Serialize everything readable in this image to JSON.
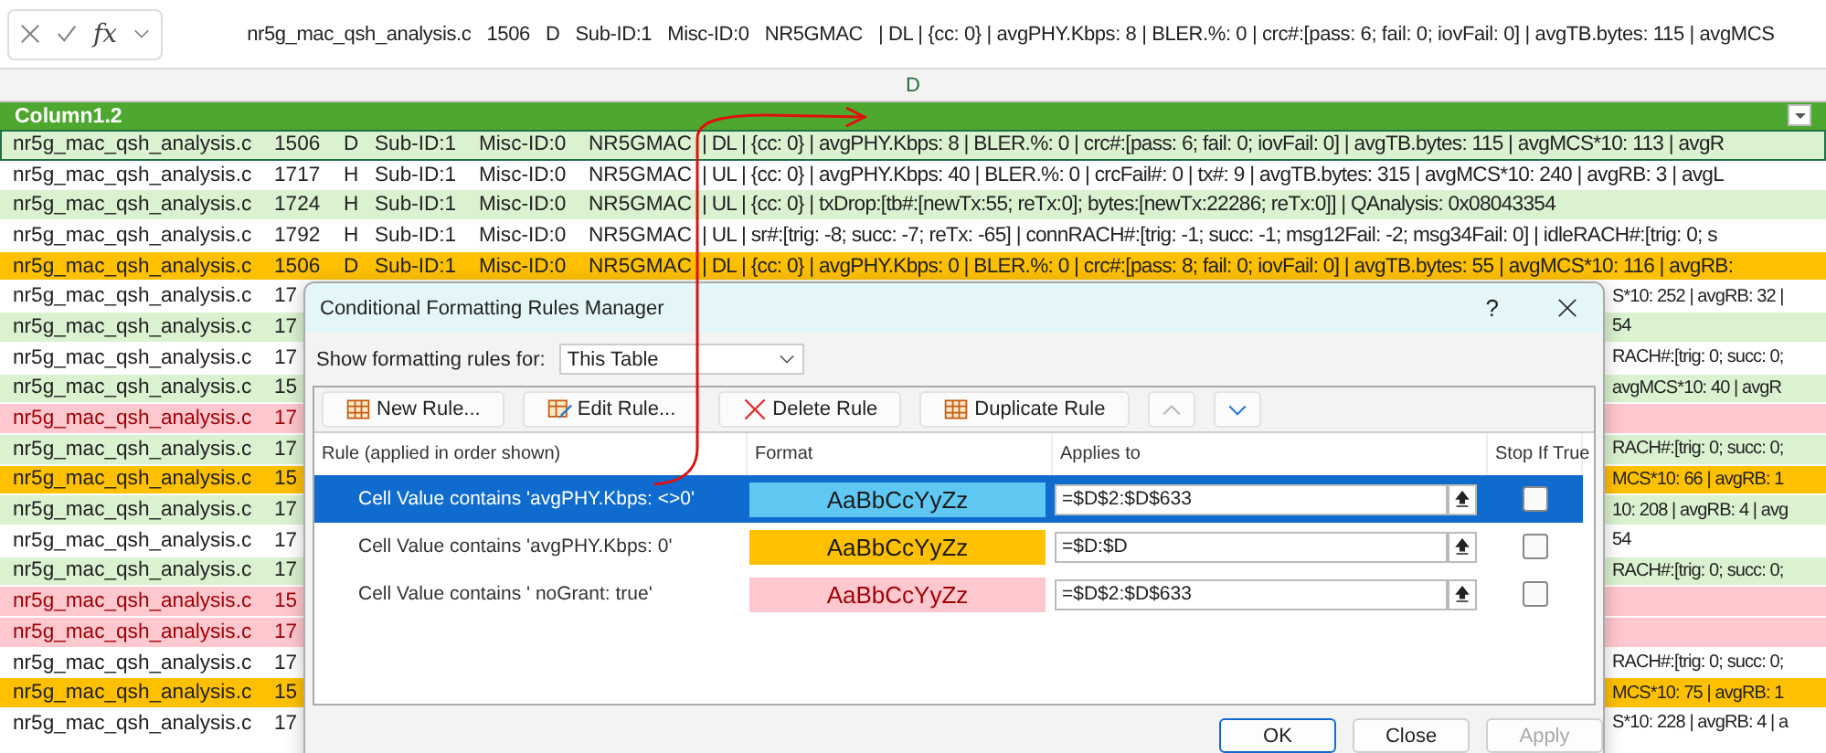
{
  "formula_bar": {
    "function_label": "fx",
    "value": "nr5g_mac_qsh_analysis.c   1506   D   Sub-ID:1   Misc-ID:0   NR5GMAC   | DL | {cc: 0} | avgPHY.Kbps: 8 | BLER.%: 0 | crc#:[pass: 6; fail: 0; iovFail: 0] | avgTB.bytes: 115 | avgMCS"
  },
  "column_letter": "D",
  "table": {
    "header": "Column1.2",
    "rows": [
      {
        "kind": "band",
        "active": true,
        "cells": [
          "nr5g_mac_qsh_analysis.c",
          "1506",
          "D",
          "Sub-ID:1",
          "Misc-ID:0",
          "NR5GMAC",
          "| DL | {cc: 0} | avgPHY.Kbps: 8 | BLER.%: 0 | crc#:[pass: 6; fail: 0; iovFail: 0] | avgTB.bytes: 115 | avgMCS*10: 113 | avgR"
        ]
      },
      {
        "kind": "plain",
        "active": false,
        "cells": [
          "nr5g_mac_qsh_analysis.c",
          "1717",
          "H",
          "Sub-ID:1",
          "Misc-ID:0",
          "NR5GMAC",
          "| UL | {cc: 0} | avgPHY.Kbps: 40 | BLER.%:  0 | crcFail#: 0 | tx#: 9 | avgTB.bytes: 315 | avgMCS*10: 240 | avgRB: 3 | avgL"
        ]
      },
      {
        "kind": "band",
        "active": false,
        "cells": [
          "nr5g_mac_qsh_analysis.c",
          "1724",
          "H",
          "Sub-ID:1",
          "Misc-ID:0",
          "NR5GMAC",
          "| UL | {cc: 0} | txDrop:[tb#:[newTx:55; reTx:0]; bytes:[newTx:22286; reTx:0]] | QAnalysis: 0x08043354"
        ]
      },
      {
        "kind": "plain",
        "active": false,
        "cells": [
          "nr5g_mac_qsh_analysis.c",
          "1792",
          "H",
          "Sub-ID:1",
          "Misc-ID:0",
          "NR5GMAC",
          "| UL | sr#:[trig: -8; succ: -7; reTx: -65] | connRACH#:[trig: -1; succ: -1; msg12Fail: -2; msg34Fail: 0] | idleRACH#:[trig: 0; s"
        ]
      },
      {
        "kind": "zero",
        "active": false,
        "cells": [
          "nr5g_mac_qsh_analysis.c",
          "1506",
          "D",
          "Sub-ID:1",
          "Misc-ID:0",
          "NR5GMAC",
          "| DL | {cc: 0} | avgPHY.Kbps: 0 | BLER.%: 0 | crc#:[pass: 8; fail: 0; iovFail: 0] | avgTB.bytes: 55 | avgMCS*10: 116 | avgRB:"
        ]
      }
    ],
    "covered_rows": [
      {
        "kind": "plain",
        "file": "nr5g_mac_qsh_analysis.c",
        "line": "17",
        "tail": "S*10: 252 | avgRB: 32 |"
      },
      {
        "kind": "band",
        "file": "nr5g_mac_qsh_analysis.c",
        "line": "17",
        "tail": "54"
      },
      {
        "kind": "plain",
        "file": "nr5g_mac_qsh_analysis.c",
        "line": "17",
        "tail": "RACH#:[trig: 0; succ: 0;"
      },
      {
        "kind": "band",
        "file": "nr5g_mac_qsh_analysis.c",
        "line": "15",
        "tail": "avgMCS*10: 40 | avgR"
      },
      {
        "kind": "nogrant",
        "file": "nr5g_mac_qsh_analysis.c",
        "line": "17"
      },
      {
        "kind": "band",
        "file": "nr5g_mac_qsh_analysis.c",
        "line": "17",
        "tail": "RACH#:[trig: 0; succ: 0;"
      },
      {
        "kind": "zero",
        "file": "nr5g_mac_qsh_analysis.c",
        "line": "15",
        "tail": "MCS*10: 66 | avgRB: 1"
      },
      {
        "kind": "band",
        "file": "nr5g_mac_qsh_analysis.c",
        "line": "17",
        "tail": "10: 208 | avgRB: 4 | avg"
      },
      {
        "kind": "plain",
        "file": "nr5g_mac_qsh_analysis.c",
        "line": "17",
        "tail": "54"
      },
      {
        "kind": "band",
        "file": "nr5g_mac_qsh_analysis.c",
        "line": "17",
        "tail": "RACH#:[trig: 0; succ: 0;"
      },
      {
        "kind": "nogrant",
        "file": "nr5g_mac_qsh_analysis.c",
        "line": "15"
      },
      {
        "kind": "nogrant",
        "file": "nr5g_mac_qsh_analysis.c",
        "line": "17"
      },
      {
        "kind": "plain",
        "file": "nr5g_mac_qsh_analysis.c",
        "line": "17",
        "tail": "RACH#:[trig: 0; succ: 0;"
      },
      {
        "kind": "zero",
        "file": "nr5g_mac_qsh_analysis.c",
        "line": "15",
        "tail": "MCS*10: 75 | avgRB: 1"
      },
      {
        "kind": "plain",
        "file": "nr5g_mac_qsh_analysis.c",
        "line": "17",
        "tail": "S*10: 228 | avgRB: 4 | a"
      }
    ]
  },
  "dialog": {
    "title": "Conditional Formatting Rules Manager",
    "help": "?",
    "scope_label": "Show formatting rules for:",
    "scope_value": "This Table",
    "toolbar": [
      {
        "kind": "new",
        "label": "New Rule...",
        "disabled": false
      },
      {
        "kind": "edit",
        "label": "Edit Rule...",
        "disabled": false
      },
      {
        "kind": "delete",
        "label": "Delete Rule",
        "disabled": false
      },
      {
        "kind": "duplicate",
        "label": "Duplicate Rule",
        "disabled": false
      },
      {
        "kind": "move_up",
        "disabled": true
      },
      {
        "kind": "move_down",
        "disabled": false
      }
    ],
    "columns": [
      "Rule (applied in order shown)",
      "Format",
      "Applies to",
      "Stop If True"
    ],
    "rules": [
      {
        "selected": true,
        "rule": "Cell Value contains 'avgPHY.Kbps: <>0'",
        "preview": "AaBbCcYyZz",
        "color": "#5ec8f2",
        "kind": "normal",
        "applies_to": "=$D$2:$D$633",
        "stop_if_true": false
      },
      {
        "selected": false,
        "rule": "Cell Value contains 'avgPHY.Kbps: 0'",
        "preview": "AaBbCcYyZz",
        "color": "#ffc000",
        "kind": "normal",
        "applies_to": "=$D:$D",
        "stop_if_true": false
      },
      {
        "selected": false,
        "rule": "Cell Value contains ' noGrant: true'",
        "preview": "AaBbCcYyZz",
        "color": "#ffc7ce",
        "kind": "alert",
        "applies_to": "=$D$2:$D$633",
        "stop_if_true": false
      }
    ],
    "buttons": [
      {
        "label": "OK",
        "disabled": false,
        "default": true
      },
      {
        "label": "Close",
        "disabled": false,
        "default": false
      },
      {
        "label": "Apply",
        "disabled": true,
        "default": false
      }
    ]
  }
}
